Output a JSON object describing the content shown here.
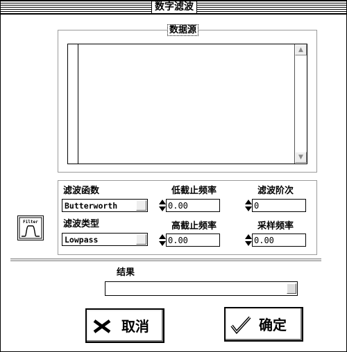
{
  "window": {
    "title": "数字滤波"
  },
  "source": {
    "label": "数据源",
    "scroll_up": "▲",
    "scroll_down": "▼"
  },
  "filter": {
    "function_label": "滤波函数",
    "function_value": "Butterworth",
    "type_label": "滤波类型",
    "type_value": "Lowpass",
    "low_cutoff_label": "低截止频率",
    "low_cutoff_value": "0.00",
    "high_cutoff_label": "高截止频率",
    "high_cutoff_value": "0.00",
    "order_label": "滤波阶次",
    "order_value": "0",
    "sample_rate_label": "采样频率",
    "sample_rate_value": "0.00",
    "icon": "filter-response-icon",
    "icon_caption": "Filter"
  },
  "result": {
    "label": "结果",
    "value": ""
  },
  "buttons": {
    "cancel_label": "取消",
    "cancel_icon": "x-icon",
    "ok_label": "确定",
    "ok_icon": "checkmark-icon"
  }
}
